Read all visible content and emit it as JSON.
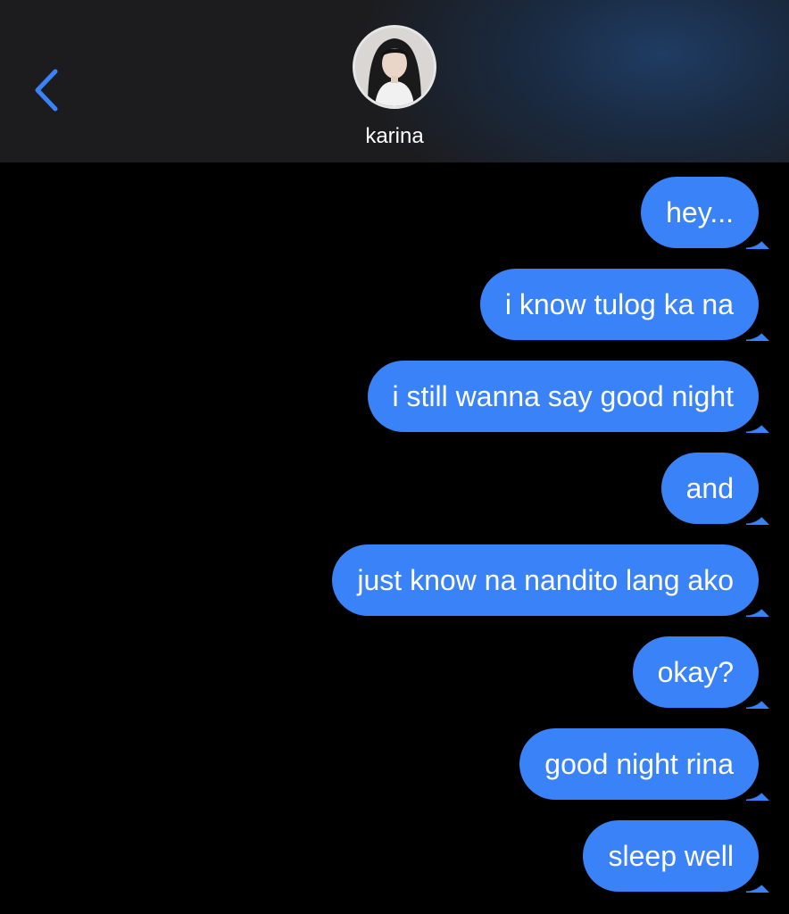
{
  "header": {
    "back_icon": "chevron-left-icon",
    "contact_name": "karina",
    "accent_color": "#3a82f7"
  },
  "messages": [
    {
      "text": "hey...",
      "direction": "outgoing"
    },
    {
      "text": "i know tulog ka na",
      "direction": "outgoing"
    },
    {
      "text": "i still wanna say good night",
      "direction": "outgoing"
    },
    {
      "text": "and",
      "direction": "outgoing"
    },
    {
      "text": "just know na nandito lang ako",
      "direction": "outgoing"
    },
    {
      "text": "okay?",
      "direction": "outgoing"
    },
    {
      "text": "good night rina",
      "direction": "outgoing"
    },
    {
      "text": "sleep well",
      "direction": "outgoing"
    }
  ],
  "colors": {
    "background": "#000000",
    "header_background": "#1c1c1e",
    "bubble_outgoing": "#3a82f7",
    "bubble_text": "#ffffff"
  }
}
